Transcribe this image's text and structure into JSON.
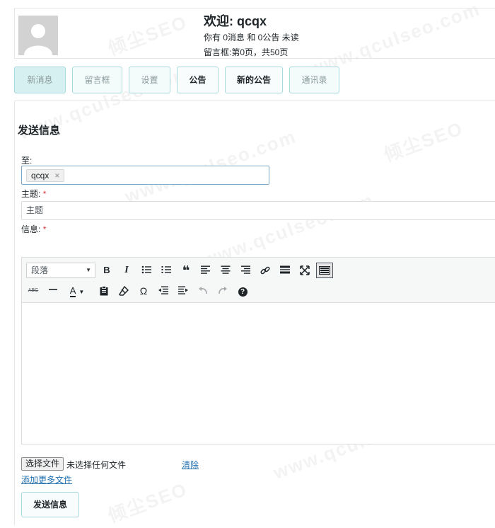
{
  "header": {
    "welcome": "欢迎: qcqx",
    "messages_line": "你有 0消息 和 0公告 未读",
    "page_line": "留言框:第0页，共50页"
  },
  "tabs": [
    {
      "label": "新消息"
    },
    {
      "label": "留言框"
    },
    {
      "label": "设置"
    },
    {
      "label": "公告"
    },
    {
      "label": "新的公告"
    },
    {
      "label": "通讯录"
    }
  ],
  "form": {
    "title": "发送信息",
    "to_label": "至:",
    "recipient": "qcqx",
    "remove_glyph": "×",
    "subject_label": "主题:",
    "subject_placeholder": "主题",
    "message_label": "信息:",
    "required_mark": "*"
  },
  "editor": {
    "format_select": "段落",
    "icons_row1": [
      "bold-icon",
      "italic-icon",
      "bullet-list-icon",
      "numbered-list-icon",
      "blockquote-icon",
      "align-left-icon",
      "align-center-icon",
      "align-right-icon",
      "link-icon",
      "read-more-icon",
      "fullscreen-icon",
      "toolbar-toggle-icon"
    ],
    "icons_row2": [
      "strikethrough-icon",
      "horizontal-line-icon",
      "text-color-icon",
      "paste-text-icon",
      "clear-formatting-icon",
      "special-character-icon",
      "outdent-icon",
      "indent-icon",
      "undo-icon",
      "redo-icon",
      "help-icon"
    ],
    "bold_glyph": "B",
    "italic_glyph": "I",
    "quote_glyph": "❝",
    "omega_glyph": "Ω",
    "text_color_glyph": "A",
    "help_glyph": "?",
    "strike_glyph": "ABC"
  },
  "files": {
    "choose_button": "选择文件",
    "no_file": "未选择任何文件",
    "clear": "清除",
    "add_more": "添加更多文件"
  },
  "send_button": "发送信息",
  "watermark": [
    "倾尘SEO",
    "www.qculseo.com"
  ],
  "colors": {
    "accent_border": "#a8d9dc",
    "link": "#2271b1",
    "required": "#d63638"
  }
}
